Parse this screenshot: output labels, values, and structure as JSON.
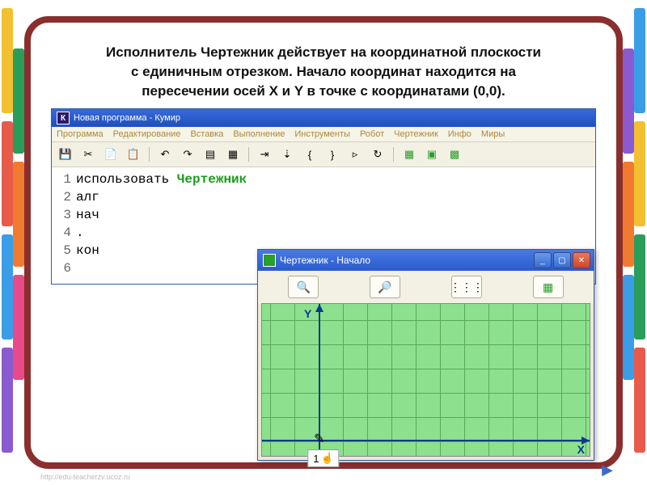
{
  "heading": {
    "l1": "Исполнитель Чертежник действует на координатной плоскости",
    "l2": "с единичным отрезком. Начало координат находится на",
    "l3": "пересечении осей X и Y  в точке с координатами (0,0)."
  },
  "main_window": {
    "title": "Новая программа - Кумир",
    "icon_letter": "К",
    "menu": [
      "Программа",
      "Редактирование",
      "Вставка",
      "Выполнение",
      "Инструменты",
      "Робот",
      "Чертежник",
      "Инфо",
      "Миры"
    ]
  },
  "code": {
    "line_numbers": [
      "1",
      "2",
      "3",
      "4",
      "5",
      "6"
    ],
    "lines": [
      {
        "segments": [
          {
            "t": "использовать "
          },
          {
            "t": "Чертежник",
            "cls": "kw-green"
          }
        ]
      },
      {
        "segments": [
          {
            "t": "алг"
          }
        ]
      },
      {
        "segments": [
          {
            "t": "нач"
          }
        ]
      },
      {
        "segments": [
          {
            "t": "."
          }
        ]
      },
      {
        "segments": [
          {
            "t": "кон"
          }
        ]
      },
      {
        "segments": [
          {
            "t": ""
          }
        ]
      }
    ]
  },
  "draftsman": {
    "title": "Чертежник - Начало",
    "axis_y": "Y",
    "axis_x": "X"
  },
  "slide_number": "1",
  "footer_url": "http://edu-teacherzv.ucoz.ru"
}
